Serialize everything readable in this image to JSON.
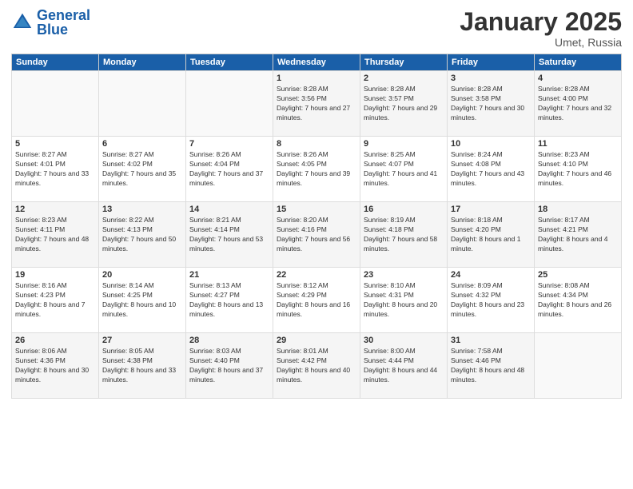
{
  "header": {
    "logo_general": "General",
    "logo_blue": "Blue",
    "month_title": "January 2025",
    "location": "Umet, Russia"
  },
  "weekdays": [
    "Sunday",
    "Monday",
    "Tuesday",
    "Wednesday",
    "Thursday",
    "Friday",
    "Saturday"
  ],
  "weeks": [
    [
      {
        "day": "",
        "sunrise": "",
        "sunset": "",
        "daylight": ""
      },
      {
        "day": "",
        "sunrise": "",
        "sunset": "",
        "daylight": ""
      },
      {
        "day": "",
        "sunrise": "",
        "sunset": "",
        "daylight": ""
      },
      {
        "day": "1",
        "sunrise": "Sunrise: 8:28 AM",
        "sunset": "Sunset: 3:56 PM",
        "daylight": "Daylight: 7 hours and 27 minutes."
      },
      {
        "day": "2",
        "sunrise": "Sunrise: 8:28 AM",
        "sunset": "Sunset: 3:57 PM",
        "daylight": "Daylight: 7 hours and 29 minutes."
      },
      {
        "day": "3",
        "sunrise": "Sunrise: 8:28 AM",
        "sunset": "Sunset: 3:58 PM",
        "daylight": "Daylight: 7 hours and 30 minutes."
      },
      {
        "day": "4",
        "sunrise": "Sunrise: 8:28 AM",
        "sunset": "Sunset: 4:00 PM",
        "daylight": "Daylight: 7 hours and 32 minutes."
      }
    ],
    [
      {
        "day": "5",
        "sunrise": "Sunrise: 8:27 AM",
        "sunset": "Sunset: 4:01 PM",
        "daylight": "Daylight: 7 hours and 33 minutes."
      },
      {
        "day": "6",
        "sunrise": "Sunrise: 8:27 AM",
        "sunset": "Sunset: 4:02 PM",
        "daylight": "Daylight: 7 hours and 35 minutes."
      },
      {
        "day": "7",
        "sunrise": "Sunrise: 8:26 AM",
        "sunset": "Sunset: 4:04 PM",
        "daylight": "Daylight: 7 hours and 37 minutes."
      },
      {
        "day": "8",
        "sunrise": "Sunrise: 8:26 AM",
        "sunset": "Sunset: 4:05 PM",
        "daylight": "Daylight: 7 hours and 39 minutes."
      },
      {
        "day": "9",
        "sunrise": "Sunrise: 8:25 AM",
        "sunset": "Sunset: 4:07 PM",
        "daylight": "Daylight: 7 hours and 41 minutes."
      },
      {
        "day": "10",
        "sunrise": "Sunrise: 8:24 AM",
        "sunset": "Sunset: 4:08 PM",
        "daylight": "Daylight: 7 hours and 43 minutes."
      },
      {
        "day": "11",
        "sunrise": "Sunrise: 8:23 AM",
        "sunset": "Sunset: 4:10 PM",
        "daylight": "Daylight: 7 hours and 46 minutes."
      }
    ],
    [
      {
        "day": "12",
        "sunrise": "Sunrise: 8:23 AM",
        "sunset": "Sunset: 4:11 PM",
        "daylight": "Daylight: 7 hours and 48 minutes."
      },
      {
        "day": "13",
        "sunrise": "Sunrise: 8:22 AM",
        "sunset": "Sunset: 4:13 PM",
        "daylight": "Daylight: 7 hours and 50 minutes."
      },
      {
        "day": "14",
        "sunrise": "Sunrise: 8:21 AM",
        "sunset": "Sunset: 4:14 PM",
        "daylight": "Daylight: 7 hours and 53 minutes."
      },
      {
        "day": "15",
        "sunrise": "Sunrise: 8:20 AM",
        "sunset": "Sunset: 4:16 PM",
        "daylight": "Daylight: 7 hours and 56 minutes."
      },
      {
        "day": "16",
        "sunrise": "Sunrise: 8:19 AM",
        "sunset": "Sunset: 4:18 PM",
        "daylight": "Daylight: 7 hours and 58 minutes."
      },
      {
        "day": "17",
        "sunrise": "Sunrise: 8:18 AM",
        "sunset": "Sunset: 4:20 PM",
        "daylight": "Daylight: 8 hours and 1 minute."
      },
      {
        "day": "18",
        "sunrise": "Sunrise: 8:17 AM",
        "sunset": "Sunset: 4:21 PM",
        "daylight": "Daylight: 8 hours and 4 minutes."
      }
    ],
    [
      {
        "day": "19",
        "sunrise": "Sunrise: 8:16 AM",
        "sunset": "Sunset: 4:23 PM",
        "daylight": "Daylight: 8 hours and 7 minutes."
      },
      {
        "day": "20",
        "sunrise": "Sunrise: 8:14 AM",
        "sunset": "Sunset: 4:25 PM",
        "daylight": "Daylight: 8 hours and 10 minutes."
      },
      {
        "day": "21",
        "sunrise": "Sunrise: 8:13 AM",
        "sunset": "Sunset: 4:27 PM",
        "daylight": "Daylight: 8 hours and 13 minutes."
      },
      {
        "day": "22",
        "sunrise": "Sunrise: 8:12 AM",
        "sunset": "Sunset: 4:29 PM",
        "daylight": "Daylight: 8 hours and 16 minutes."
      },
      {
        "day": "23",
        "sunrise": "Sunrise: 8:10 AM",
        "sunset": "Sunset: 4:31 PM",
        "daylight": "Daylight: 8 hours and 20 minutes."
      },
      {
        "day": "24",
        "sunrise": "Sunrise: 8:09 AM",
        "sunset": "Sunset: 4:32 PM",
        "daylight": "Daylight: 8 hours and 23 minutes."
      },
      {
        "day": "25",
        "sunrise": "Sunrise: 8:08 AM",
        "sunset": "Sunset: 4:34 PM",
        "daylight": "Daylight: 8 hours and 26 minutes."
      }
    ],
    [
      {
        "day": "26",
        "sunrise": "Sunrise: 8:06 AM",
        "sunset": "Sunset: 4:36 PM",
        "daylight": "Daylight: 8 hours and 30 minutes."
      },
      {
        "day": "27",
        "sunrise": "Sunrise: 8:05 AM",
        "sunset": "Sunset: 4:38 PM",
        "daylight": "Daylight: 8 hours and 33 minutes."
      },
      {
        "day": "28",
        "sunrise": "Sunrise: 8:03 AM",
        "sunset": "Sunset: 4:40 PM",
        "daylight": "Daylight: 8 hours and 37 minutes."
      },
      {
        "day": "29",
        "sunrise": "Sunrise: 8:01 AM",
        "sunset": "Sunset: 4:42 PM",
        "daylight": "Daylight: 8 hours and 40 minutes."
      },
      {
        "day": "30",
        "sunrise": "Sunrise: 8:00 AM",
        "sunset": "Sunset: 4:44 PM",
        "daylight": "Daylight: 8 hours and 44 minutes."
      },
      {
        "day": "31",
        "sunrise": "Sunrise: 7:58 AM",
        "sunset": "Sunset: 4:46 PM",
        "daylight": "Daylight: 8 hours and 48 minutes."
      },
      {
        "day": "",
        "sunrise": "",
        "sunset": "",
        "daylight": ""
      }
    ]
  ]
}
